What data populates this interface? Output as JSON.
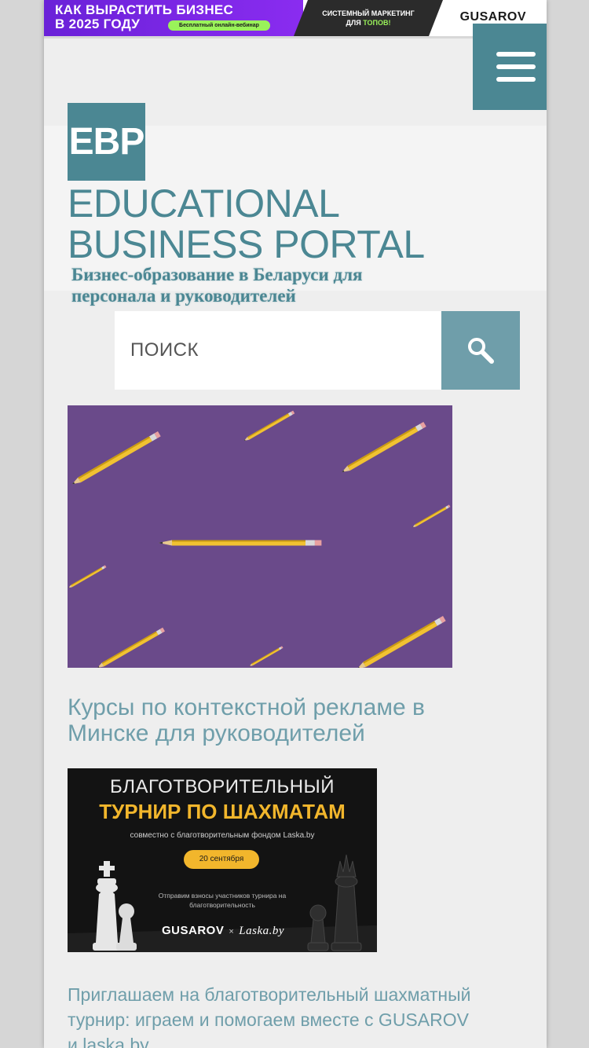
{
  "banner": {
    "headline": "КАК ВЫРАСТИТЬ БИЗНЕС\nВ 2025 ГОДУ",
    "pill": "Бесплатный онлайн-вебинар",
    "mid_line1": "СИСТЕМНЫЙ МАРКЕТИНГ",
    "mid_line2_prefix": "ДЛЯ ",
    "mid_line2_highlight": "ТОПОВ!",
    "brand": "GUSAROV",
    "colors": {
      "left_bg": "#7a27e6",
      "accent": "#9af25a",
      "dark": "#2b2b2b"
    }
  },
  "menu": {
    "icon": "hamburger-menu-icon",
    "color": "#4b8793"
  },
  "header": {
    "logo_text": "EBP",
    "title": "EDUCATIONAL\nBUSINESS PORTAL",
    "tagline": "Бизнес-образование в Беларуси для персонала и руководителей",
    "accent_color": "#4b8793"
  },
  "search": {
    "placeholder": "ПОИСК",
    "icon": "search-icon",
    "button_color": "#6f9eaa"
  },
  "posts": [
    {
      "image": "pencils-on-purple-background",
      "title": "Курсы по контекстной рекламе в Минске для руководителей"
    },
    {
      "image": "chess-tournament-banner",
      "banner_line1": "БЛАГОТВОРИТЕЛЬНЫЙ",
      "banner_line2": "ТУРНИР ПО ШАХМАТАМ",
      "banner_sub": "совместно с благотворительным фондом Laska.by",
      "banner_date": "20 сентября",
      "banner_note": "Отправим взносы участников турнира на благотворительность",
      "banner_brand1": "GUSAROV",
      "banner_brand_sep": "×",
      "banner_brand2": "Laska.by",
      "title": "Приглашаем на благотворительный шахматный турнир: играем и помогаем вместе с GUSAROV и laska.by"
    }
  ]
}
